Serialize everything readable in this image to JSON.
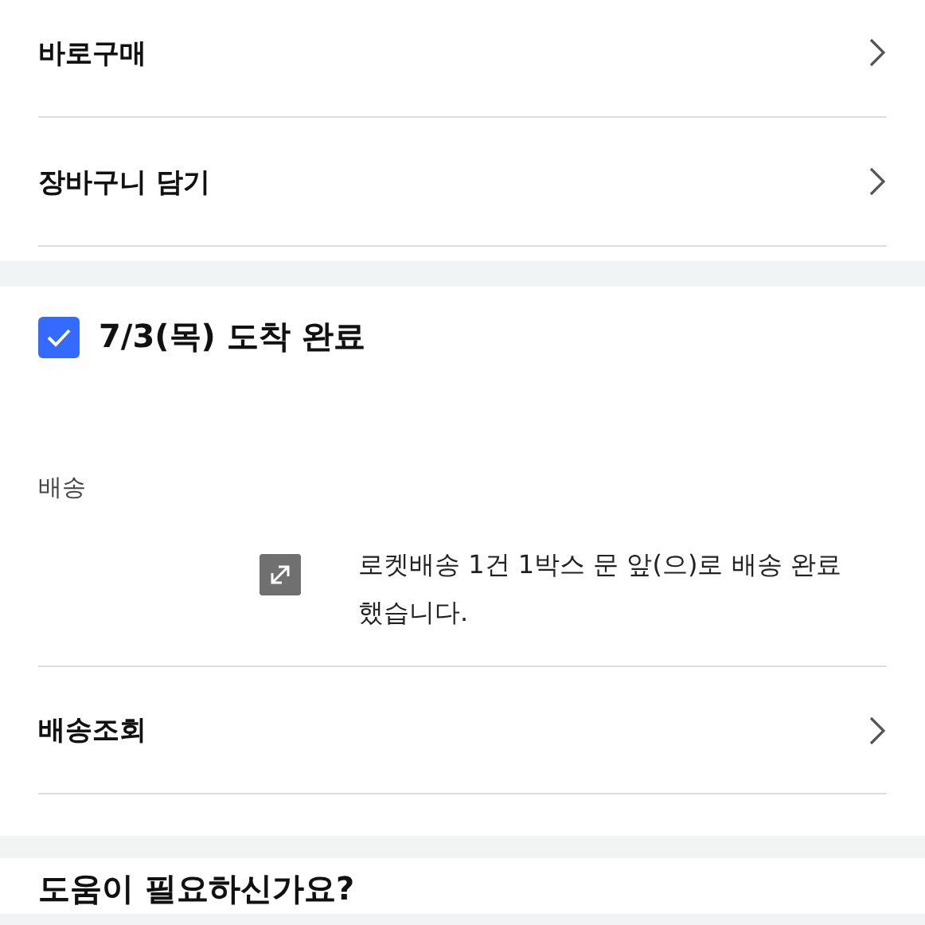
{
  "top_actions": [
    {
      "label": "바로구매"
    },
    {
      "label": "장바구니 담기"
    }
  ],
  "delivery": {
    "checked": true,
    "title": "7/3(목) 도착 완료",
    "info_label": "배송",
    "message": "로켓배송 1건 1박스 문 앞(으)로 배송 완료했습니다.",
    "tracking": {
      "label": "배송조회"
    }
  },
  "help": {
    "title": "도움이 필요하신가요?"
  }
}
